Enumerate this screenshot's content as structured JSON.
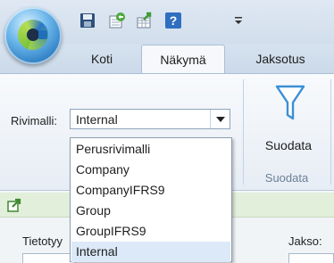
{
  "quick_access": {
    "buttons": [
      {
        "name": "save-icon"
      },
      {
        "name": "new-record-icon"
      },
      {
        "name": "export-icon"
      },
      {
        "name": "help-icon"
      },
      {
        "name": "customize-qat-icon"
      }
    ]
  },
  "tabs": [
    {
      "label": "Koti",
      "active": false
    },
    {
      "label": "Näkymä",
      "active": true
    },
    {
      "label": "Jaksotus",
      "active": false
    }
  ],
  "ribbon": {
    "row_model_label": "Rivimalli:",
    "row_model_value": "Internal",
    "filter_button_label": "Suodata",
    "filter_group_label": "Suodata"
  },
  "dropdown": {
    "options": [
      "Perusrivimalli",
      "Company",
      "CompanyIFRS9",
      "Group",
      "GroupIFRS9",
      "Internal"
    ],
    "selected": "Internal"
  },
  "panel": {
    "left_label": "Tietotyy",
    "right_label": "Jakso:"
  },
  "colors": {
    "ribbon_bg": "#f3f6fa",
    "accent_blue": "#1f70b9",
    "filter_icon": "#3a8fd6",
    "selected_item": "#dbe9f8",
    "panel_strip": "#e2efdb"
  }
}
